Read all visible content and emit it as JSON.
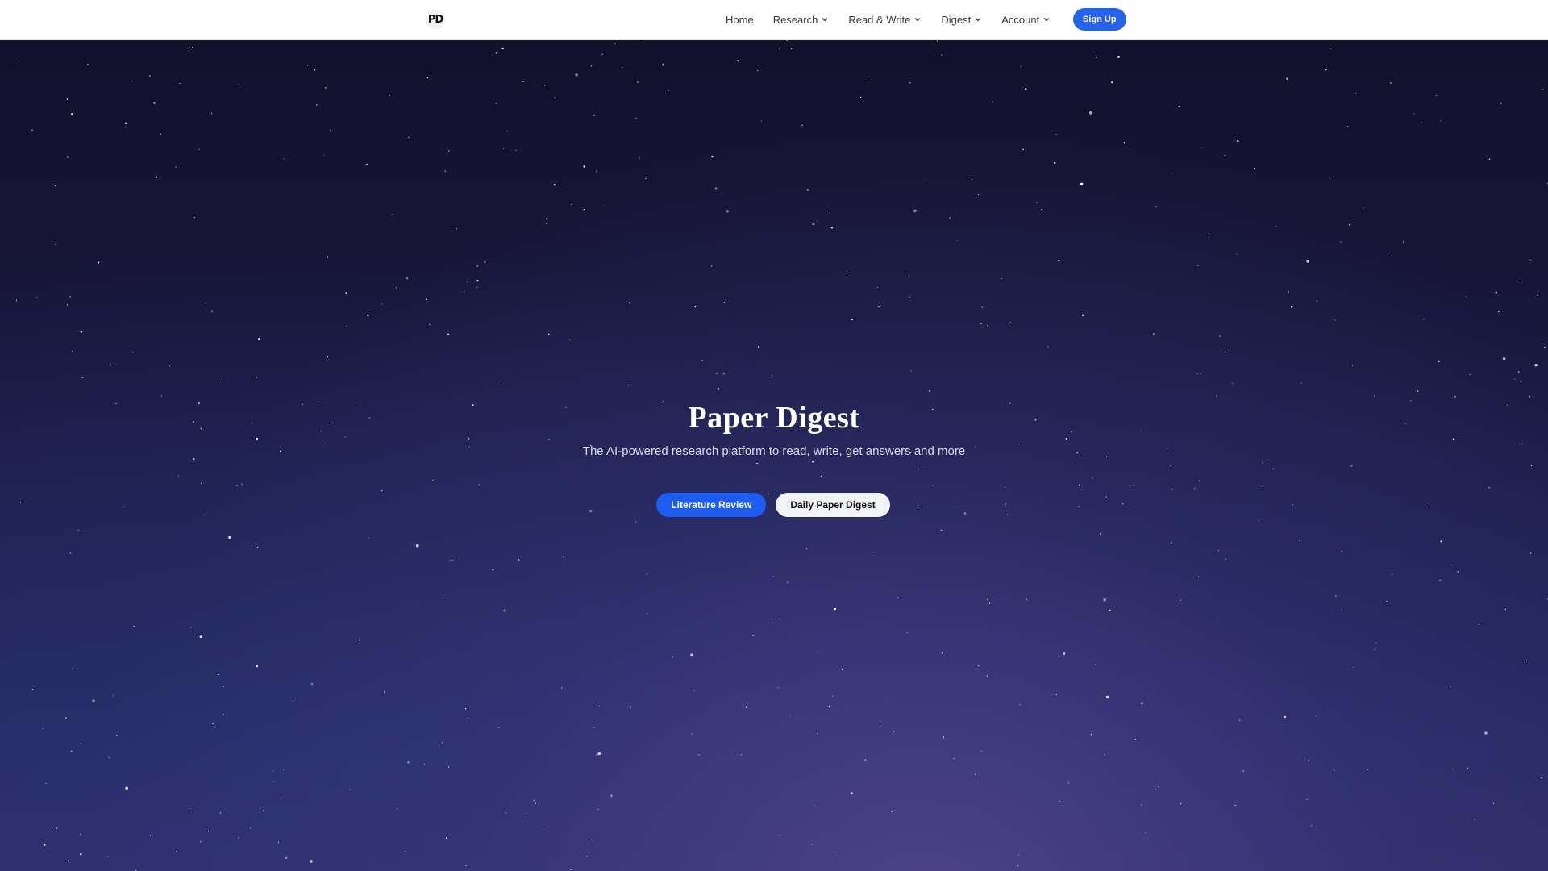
{
  "nav": {
    "logo_text": "PD",
    "links": [
      {
        "label": "Home",
        "has_dropdown": false
      },
      {
        "label": "Research",
        "has_dropdown": true
      },
      {
        "label": "Read & Write",
        "has_dropdown": true
      },
      {
        "label": "Digest",
        "has_dropdown": true
      },
      {
        "label": "Account",
        "has_dropdown": true
      }
    ],
    "signup_label": "Sign Up"
  },
  "hero": {
    "title": "Paper Digest",
    "subtitle": "The AI-powered research platform to read, write, get answers and more",
    "primary_button": "Literature Review",
    "secondary_button": "Daily Paper Digest"
  },
  "colors": {
    "accent": "#2563eb",
    "nav_bg": "#ffffff",
    "hero_top": "#12102a",
    "hero_bottom": "#2e2c66"
  }
}
